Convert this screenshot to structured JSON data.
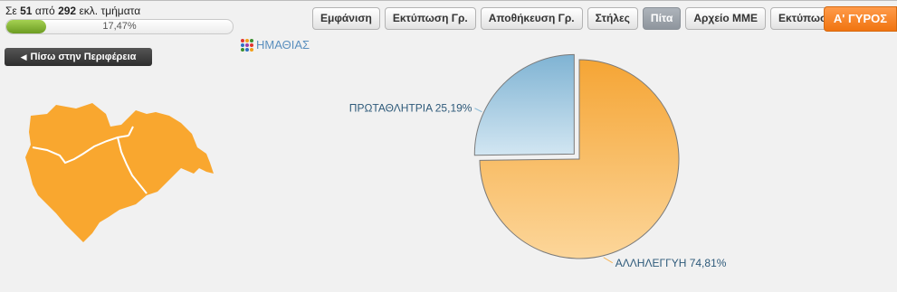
{
  "progress": {
    "prefix": "Σε",
    "reported": "51",
    "middle": "από",
    "total": "292",
    "suffix": "εκλ. τμήματα",
    "percent_label": "17,47%",
    "percent_value": 17.47
  },
  "toolbar": {
    "buttons": [
      {
        "label": "Εμφάνιση",
        "active": false
      },
      {
        "label": "Εκτύπωση Γρ.",
        "active": false
      },
      {
        "label": "Αποθήκευση Γρ.",
        "active": false
      },
      {
        "label": "Στήλες",
        "active": false
      },
      {
        "label": "Πίτα",
        "active": true
      },
      {
        "label": "Αρχείο ΜΜΕ",
        "active": false
      },
      {
        "label": "Εκτύπωση",
        "active": false
      }
    ],
    "round_label": "Α' ΓΥΡΟΣ"
  },
  "back_button": {
    "label": "Πίσω στην Περιφέρεια",
    "icon": "left-triangle-icon"
  },
  "region": {
    "name": "ΗΜΑΘΙΑΣ",
    "icon": "color-dots-icon",
    "dot_colors": [
      "#e0342d",
      "#f2a01a",
      "#3a8f2f",
      "#2d6fc2",
      "#9b3ea8",
      "#e0342d",
      "#3a8f2f",
      "#2d6fc2",
      "#f2a01a"
    ]
  },
  "map": {
    "fill": "#f9a72f",
    "stroke": "#ffffff"
  },
  "colors": {
    "accent_orange": "#f07410",
    "progress_green": "#8cbf3a",
    "label_text": "#2e5a7a"
  },
  "chart_data": {
    "type": "pie",
    "slices": [
      {
        "label": "ΑΛΛΗΛΕΓΓΥΗ",
        "value": 74.81,
        "value_label": "74,81%",
        "color": "#f7b04a",
        "exploded": false
      },
      {
        "label": "ΠΡΩΤΑΘΛΗΤΡΙΑ",
        "value": 25.19,
        "value_label": "25,19%",
        "color": "#8cbcd8",
        "exploded": true
      }
    ],
    "title": "",
    "legend": false
  }
}
